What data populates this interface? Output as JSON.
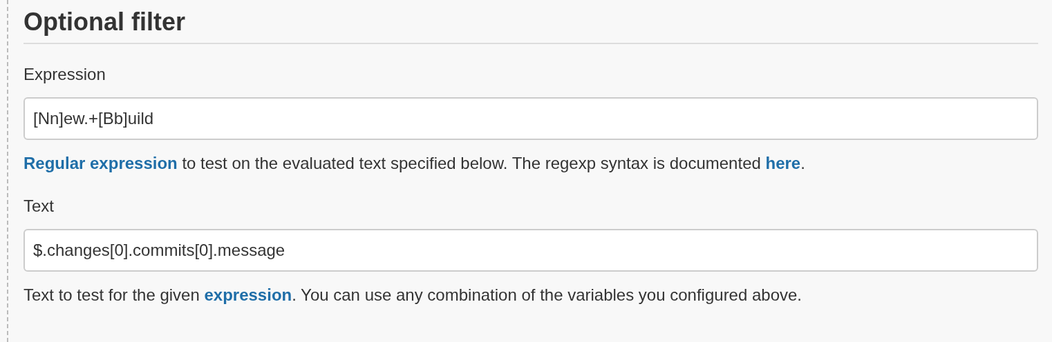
{
  "section": {
    "title": "Optional filter"
  },
  "fields": [
    {
      "label": "Expression",
      "value": "[Nn]ew.+[Bb]uild",
      "help": [
        {
          "kind": "link",
          "text": "Regular expression"
        },
        {
          "kind": "text",
          "text": " to test on the evaluated text specified below. The regexp syntax is documented "
        },
        {
          "kind": "link",
          "text": "here"
        },
        {
          "kind": "text",
          "text": "."
        }
      ]
    },
    {
      "label": "Text",
      "value": "$.changes[0].commits[0].message",
      "help": [
        {
          "kind": "text",
          "text": "Text to test for the given "
        },
        {
          "kind": "link",
          "text": "expression"
        },
        {
          "kind": "text",
          "text": ". You can use any combination of the variables you configured above."
        }
      ]
    }
  ]
}
